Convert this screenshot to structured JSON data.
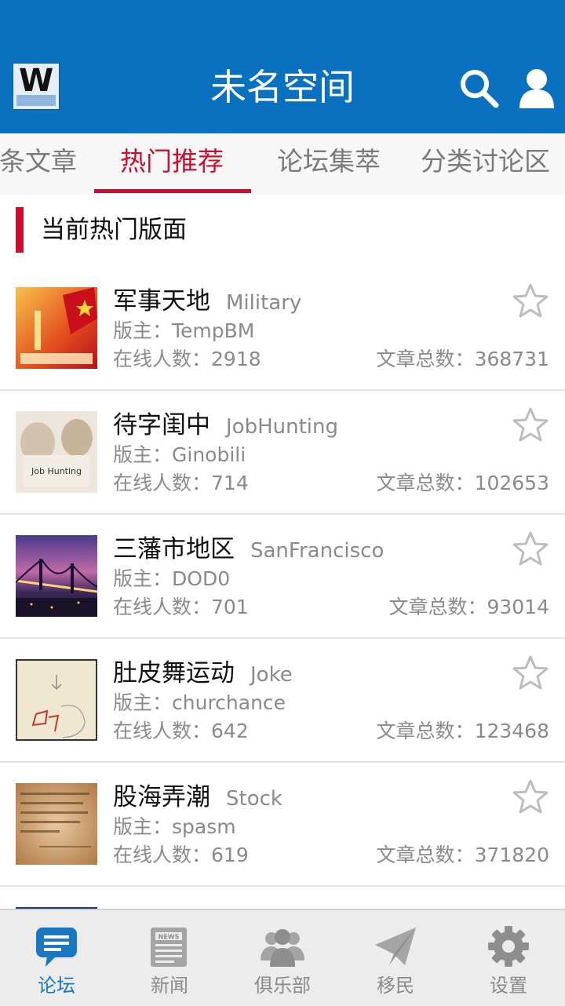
{
  "header": {
    "title": "未名空间",
    "logo_icon": "wm-logo-icon",
    "search_icon": "search-icon",
    "user_icon": "user-icon",
    "color": "#0a70c0"
  },
  "tabs": [
    {
      "label": "头条文章",
      "active": false
    },
    {
      "label": "热门推荐",
      "active": true
    },
    {
      "label": "论坛集萃",
      "active": false
    },
    {
      "label": "分类讨论区",
      "active": false
    }
  ],
  "section": {
    "title": "当前热门版面"
  },
  "labels": {
    "moderator": "版主：",
    "online": "在线人数：",
    "total": "文章总数："
  },
  "boards": [
    {
      "name": "军事天地",
      "en": "Military",
      "moderator": "TempBM",
      "online": "2918",
      "total": "368731",
      "thumb": "military-thumb"
    },
    {
      "name": "待字闺中",
      "en": "JobHunting",
      "moderator": "Ginobili",
      "online": "714",
      "total": "102653",
      "thumb": "job-hunting-thumb"
    },
    {
      "name": "三藩市地区",
      "en": "SanFrancisco",
      "moderator": "DOD0",
      "online": "701",
      "total": "93014",
      "thumb": "bridge-night-thumb"
    },
    {
      "name": "肚皮舞运动",
      "en": "Joke",
      "moderator": "churchance",
      "online": "642",
      "total": "123468",
      "thumb": "sketch-thumb"
    },
    {
      "name": "股海弄潮",
      "en": "Stock",
      "moderator": "spasm",
      "online": "619",
      "total": "371820",
      "thumb": "quote-thumb"
    }
  ],
  "bottom_nav": [
    {
      "label": "论坛",
      "icon": "forum-icon",
      "active": true
    },
    {
      "label": "新闻",
      "icon": "news-icon",
      "active": false
    },
    {
      "label": "俱乐部",
      "icon": "club-icon",
      "active": false
    },
    {
      "label": "移民",
      "icon": "paper-plane-icon",
      "active": false
    },
    {
      "label": "设置",
      "icon": "gear-icon",
      "active": false
    }
  ],
  "colors": {
    "accent": "#c8102e",
    "nav_active": "#1a78c2",
    "text_secondary": "#8a8a8a"
  }
}
